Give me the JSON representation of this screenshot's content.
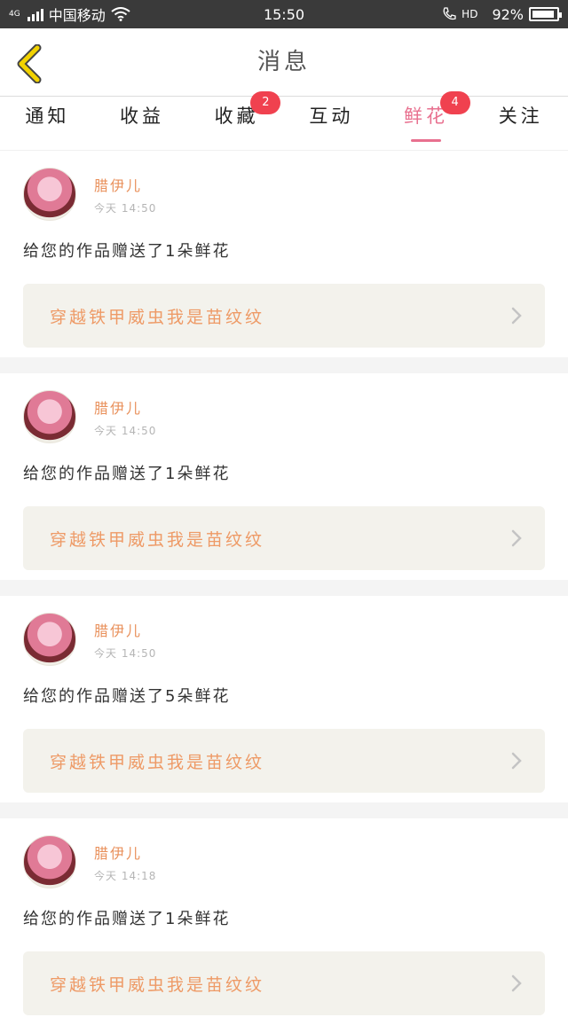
{
  "status_bar": {
    "network": "4G",
    "carrier": "中国移动",
    "time": "15:50",
    "hd": "HD",
    "battery_text": "92%",
    "battery_level": 0.92
  },
  "header": {
    "title": "消息",
    "back_icon": "chevron-left-icon",
    "accent_color": "#f2d200"
  },
  "tabs": [
    {
      "label": "通知",
      "badge": ""
    },
    {
      "label": "收益",
      "badge": ""
    },
    {
      "label": "收藏",
      "badge": "2"
    },
    {
      "label": "互动",
      "badge": ""
    },
    {
      "label": "鲜花",
      "badge": "4",
      "active": true
    },
    {
      "label": "关注",
      "badge": ""
    }
  ],
  "colors": {
    "active_tab": "#e8708f",
    "badge": "#f0414f",
    "username": "#e9915c",
    "work_title": "#ee9a66"
  },
  "messages": [
    {
      "username": "腊伊儿",
      "time": "今天 14:50",
      "text": "给您的作品赠送了1朵鲜花",
      "work_title": "穿越铁甲威虫我是苗纹纹"
    },
    {
      "username": "腊伊儿",
      "time": "今天 14:50",
      "text": "给您的作品赠送了1朵鲜花",
      "work_title": "穿越铁甲威虫我是苗纹纹"
    },
    {
      "username": "腊伊儿",
      "time": "今天 14:50",
      "text": "给您的作品赠送了5朵鲜花",
      "work_title": "穿越铁甲威虫我是苗纹纹"
    },
    {
      "username": "腊伊儿",
      "time": "今天 14:18",
      "text": "给您的作品赠送了1朵鲜花",
      "work_title": "穿越铁甲威虫我是苗纹纹"
    }
  ]
}
